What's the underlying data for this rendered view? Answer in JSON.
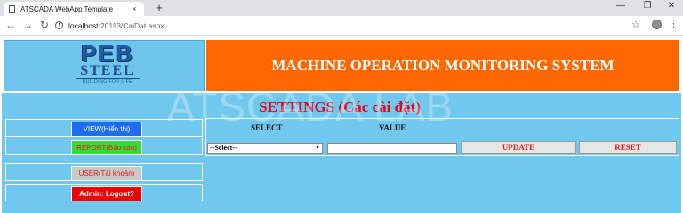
{
  "browser": {
    "tab_title": "ATSCADA WebApp Template",
    "tab_close": "×",
    "new_tab": "+",
    "minimize": "—",
    "restore": "❐",
    "close": "✕",
    "back": "←",
    "forward": "→",
    "reload": "↻",
    "url_host": "localhost",
    "url_path": ":20113/CaiDat.aspx",
    "star": "☆",
    "menu": "⋮"
  },
  "header": {
    "logo_main": "PEB",
    "logo_sub": "STEEL",
    "logo_tagline": "BUILDING FOR LIFE",
    "system_title": "MACHINE OPERATION MONITORING SYSTEM"
  },
  "watermark": "ATSCADA LAB",
  "settings": {
    "title": "SETTINGS (Các cài đặt)",
    "select_header": "SELECT",
    "value_header": "VALUE",
    "select_value": "--Select--",
    "value_input": "",
    "update_label": "UPDATE",
    "reset_label": "RESET"
  },
  "menu": {
    "view_label": "VIEW(Hiển thị)",
    "report_label": "REPORT(Báo cáo)",
    "user_label": "USER(Tài khoản)",
    "logout_label": "Admin: Logout?"
  },
  "colors": {
    "header_orange": "#ff6800",
    "panel_blue": "#70c8ee",
    "title_red": "#e8001c"
  }
}
